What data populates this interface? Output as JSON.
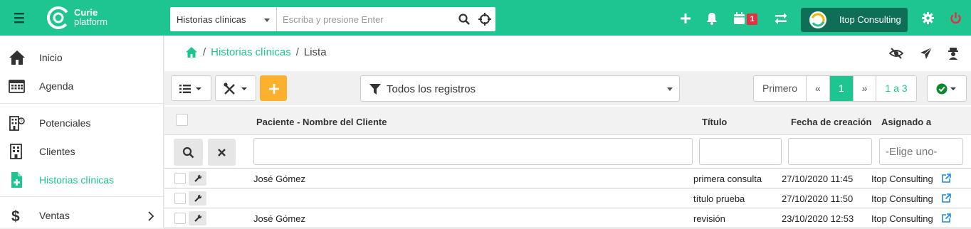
{
  "app": {
    "logo_line1": "Curie",
    "logo_line2": "platform",
    "brand_color": "#1fc590"
  },
  "search": {
    "category": "Historias clínicas",
    "placeholder": "Escriba y presione Enter"
  },
  "topbar": {
    "calendar_badge": "1",
    "company_name": "Itop Consulting"
  },
  "sidebar": {
    "items": [
      {
        "label": "Inicio",
        "icon": "home-icon"
      },
      {
        "label": "Agenda",
        "icon": "calendar-icon"
      },
      {
        "label": "Potenciales",
        "icon": "building-question-icon"
      },
      {
        "label": "Clientes",
        "icon": "building-icon"
      },
      {
        "label": "Historias clínicas",
        "icon": "file-plus-icon",
        "active": true
      },
      {
        "label": "Ventas",
        "icon": "dollar-icon"
      }
    ]
  },
  "breadcrumb": {
    "section": "Historias clínicas",
    "current": "Lista"
  },
  "toolbar": {
    "filter_label": "Todos los registros"
  },
  "pager": {
    "first": "Primero",
    "prev": "«",
    "page": "1",
    "next": "»",
    "range": "1 a 3"
  },
  "table": {
    "headers": {
      "patient": "Paciente - Nombre del Cliente",
      "title": "Título",
      "created": "Fecha de creación",
      "assigned": "Asignado a"
    },
    "assigned_placeholder": "-Elige uno-",
    "rows": [
      {
        "patient": "José Gómez",
        "title": "primera consulta",
        "created": "27/10/2020 11:45",
        "assigned": "Itop Consulting"
      },
      {
        "patient": "",
        "title": "título prueba",
        "created": "27/10/2020 11:50",
        "assigned": "Itop Consulting"
      },
      {
        "patient": "José Gómez",
        "title": "revisión",
        "created": "23/10/2020 12:53",
        "assigned": "Itop Consulting"
      }
    ]
  }
}
